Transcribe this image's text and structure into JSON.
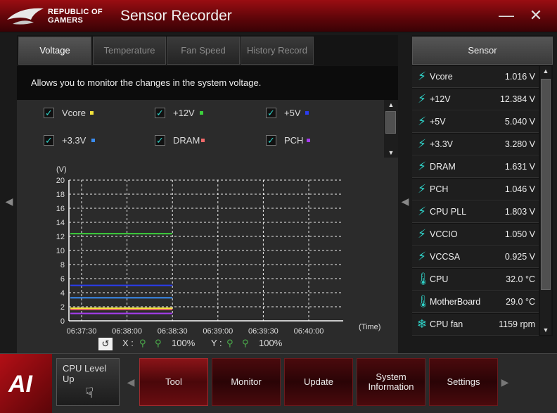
{
  "window": {
    "brand_line1": "REPUBLIC OF",
    "brand_line2": "GAMERS",
    "title": "Sensor Recorder",
    "minimize_glyph": "—",
    "close_glyph": "✕"
  },
  "tabs": [
    {
      "label": "Voltage",
      "active": true
    },
    {
      "label": "Temperature",
      "active": false
    },
    {
      "label": "Fan Speed",
      "active": false
    },
    {
      "label": "History Record",
      "active": false
    }
  ],
  "description": "Allows you to monitor the changes in the system voltage.",
  "checkboxes": [
    {
      "label": "Vcore",
      "checked": true,
      "color": "#f2e23c"
    },
    {
      "label": "+12V",
      "checked": true,
      "color": "#3ccf3c"
    },
    {
      "label": "+5V",
      "checked": true,
      "color": "#2a3cf0"
    },
    {
      "label": "+3.3V",
      "checked": true,
      "color": "#3a8cf0"
    },
    {
      "label": "DRAM",
      "checked": true,
      "color": "#f06a6a"
    },
    {
      "label": "PCH",
      "checked": true,
      "color": "#a63cf0"
    }
  ],
  "chart_data": {
    "type": "line",
    "ylabel": "(V)",
    "xlabel": "(Time)",
    "ylim": [
      0,
      20
    ],
    "y_ticks": [
      0,
      2,
      4,
      6,
      8,
      10,
      12,
      14,
      16,
      18,
      20
    ],
    "x_ticks": [
      "06:37:30",
      "06:38:00",
      "06:38:30",
      "06:39:00",
      "06:39:30",
      "06:40:00"
    ],
    "grid": true,
    "series": [
      {
        "name": "+12V",
        "color": "#3ccf3c",
        "x": [
          "06:37:30",
          "06:38:30"
        ],
        "values": [
          12.384,
          12.384
        ]
      },
      {
        "name": "+5V",
        "color": "#2a3cf0",
        "x": [
          "06:37:30",
          "06:38:30"
        ],
        "values": [
          5.04,
          5.04
        ]
      },
      {
        "name": "+3.3V",
        "color": "#3a8cf0",
        "x": [
          "06:37:30",
          "06:38:30"
        ],
        "values": [
          3.28,
          3.28
        ]
      },
      {
        "name": "DRAM",
        "color": "#f06a6a",
        "x": [
          "06:37:30",
          "06:38:30"
        ],
        "values": [
          1.631,
          1.631
        ]
      },
      {
        "name": "Vcore",
        "color": "#f2e23c",
        "x": [
          "06:37:30",
          "06:38:30"
        ],
        "values": [
          1.8,
          1.8
        ]
      },
      {
        "name": "PCH",
        "color": "#a63cf0",
        "x": [
          "06:37:30",
          "06:38:30"
        ],
        "values": [
          1.046,
          1.046
        ]
      }
    ]
  },
  "chart_controls": {
    "x_label": "X :",
    "x_zoom": "100%",
    "y_label": "Y :",
    "y_zoom": "100%"
  },
  "sensor_panel": {
    "header": "Sensor",
    "rows": [
      {
        "icon": "bolt-icon",
        "name": "Vcore",
        "value": "1.016  V"
      },
      {
        "icon": "bolt-icon",
        "name": "+12V",
        "value": "12.384  V"
      },
      {
        "icon": "bolt-icon",
        "name": "+5V",
        "value": "5.040  V"
      },
      {
        "icon": "bolt-icon",
        "name": "+3.3V",
        "value": "3.280  V"
      },
      {
        "icon": "bolt-icon",
        "name": "DRAM",
        "value": "1.631  V"
      },
      {
        "icon": "bolt-icon",
        "name": "PCH",
        "value": "1.046  V"
      },
      {
        "icon": "bolt-icon",
        "name": "CPU PLL",
        "value": "1.803  V"
      },
      {
        "icon": "bolt-icon",
        "name": "VCCIO",
        "value": "1.050  V"
      },
      {
        "icon": "bolt-icon",
        "name": "VCCSA",
        "value": "0.925  V"
      },
      {
        "icon": "thermometer-icon",
        "name": "CPU",
        "value": "32.0 °C"
      },
      {
        "icon": "thermometer-icon",
        "name": "MotherBoard",
        "value": "29.0 °C"
      },
      {
        "icon": "fan-icon",
        "name": "CPU fan",
        "value": "1159  rpm"
      }
    ]
  },
  "bottom_bar": {
    "logo_text": "AI",
    "cpu_level_up": "CPU Level Up",
    "buttons": [
      {
        "label": "Tool",
        "active": true
      },
      {
        "label": "Monitor",
        "active": false
      },
      {
        "label": "Update",
        "active": false
      },
      {
        "label": "System Information",
        "active": false
      },
      {
        "label": "Settings",
        "active": false
      }
    ]
  }
}
